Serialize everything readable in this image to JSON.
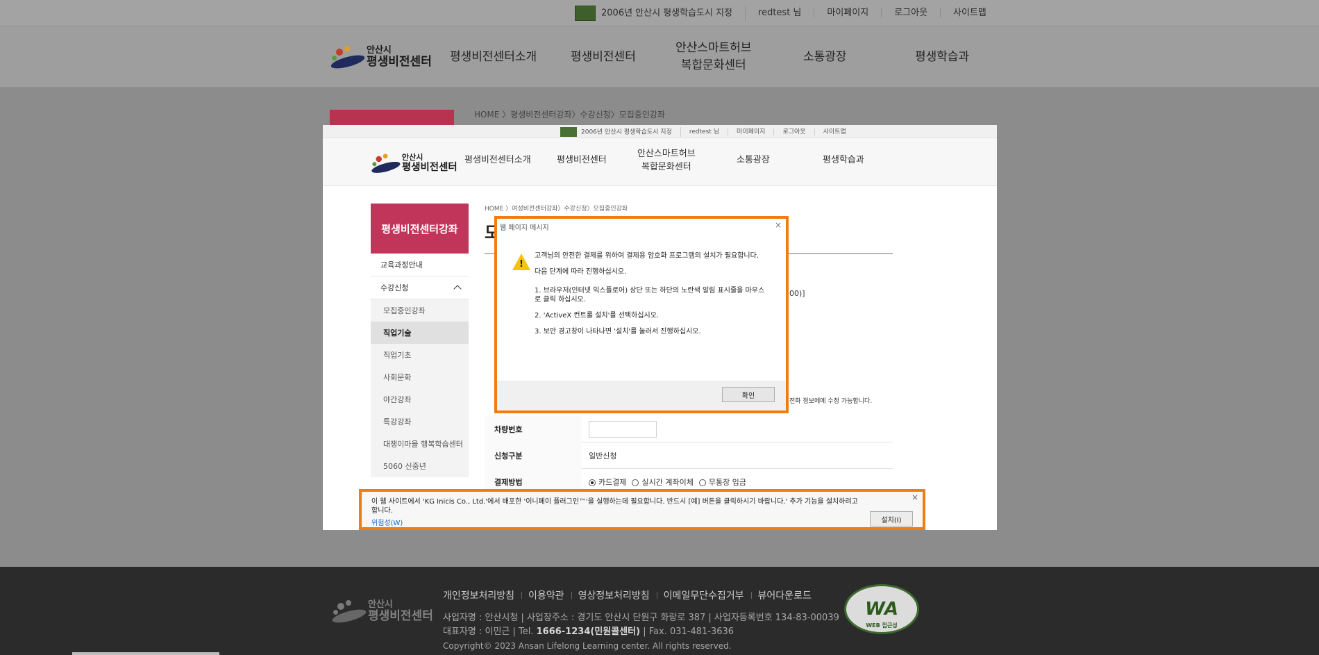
{
  "topbar": {
    "badge_text": "2006년 안산시 평생학습도시 지정",
    "user": "redtest 님",
    "mypage": "마이페이지",
    "logout": "로그아웃",
    "sitemap": "사이트맵"
  },
  "logo": {
    "line1": "안산시",
    "line2": "평생비전센터"
  },
  "gnb": [
    "평생비전센터소개",
    "평생비전센터",
    "안산스마트허브\n복합문화센터",
    "소통광장",
    "평생학습과"
  ],
  "breadcrumb": "HOME 〉평생비전센터강좌〉수강신청〉모집중인강좌",
  "inner": {
    "breadcrumb": "HOME 〉여성비전센터강좌〉수강신청〉모집중인강좌",
    "title_fragment": "모",
    "lnb": {
      "title": "평생비전센터강좌",
      "item1": "교육과정안내",
      "item2": "수강신청",
      "subs": [
        "모집중인강좌",
        "직업기술",
        "직업기초",
        "사회문화",
        "야간강좌",
        "특강강좌",
        "대쟁이마을 행복학습센터",
        "5060 신중년"
      ]
    },
    "peek_value": "00)]",
    "peek_note": "전화 정보에에 수정 가능합니다.",
    "rows": {
      "car_label": "차량번호",
      "type_label": "신청구분",
      "type_value": "일반신청",
      "pay_label": "결제방법",
      "pay_opt1": "카드결제",
      "pay_opt2": "실시간 계좌이체",
      "pay_opt3": "무통장 입금"
    }
  },
  "modal": {
    "title": "웹 페이지 메시지",
    "close": "×",
    "line1": "고객님의 안전한 결제를 위하여 결제용 암호화 프로그램의 설치가 필요합니다.",
    "line2": "다음 단계에 따라 진행하십시오.",
    "step1": "1. 브라우저(인터넷 익스플로어) 상단 또는 하단의 노란색 알림 표시줄을 마우스로 클릭 하십시오.",
    "step2": "2. 'ActiveX 컨트롤 설치'를 선택하십시오.",
    "step3": "3. 보안 경고창이 나타나면 '설치'를 눌러서 진행하십시오.",
    "ok": "확인"
  },
  "axbar": {
    "text": "이 웹 사이트에서 'KG Inicis Co., Ltd.'에서 배포한 '이니페이 플러그인™'을 실행하는데 필요합니다. 반드시 [예] 버튼을 클릭하시기 바랍니다.' 추가 기능을 설치하려고 합니다.",
    "risk_link": "위험성(W)",
    "install": "설치(I)",
    "close": "×"
  },
  "footer": {
    "links": [
      "개인정보처리방침",
      "이용약관",
      "영상정보처리방침",
      "이메일무단수집거부",
      "뷰어다운로드"
    ],
    "line1": "사업자명 : 안산시청 | 사업장주소 : 경기도 안산시 단원구 화랑로 387 | 사업자등록번호 134-83-00039",
    "line2_pre": "대표자명 : 이민근 | Tel.",
    "line2_tel": "1666-1234(민원콜센터)",
    "line2_post": "| Fax. 031-481-3636",
    "copyright": "Copyright© 2023 Ansan Lifelong Learning center. All rights reserved.",
    "wa_text": "WA",
    "wa_caption": "WEB 접근성"
  }
}
